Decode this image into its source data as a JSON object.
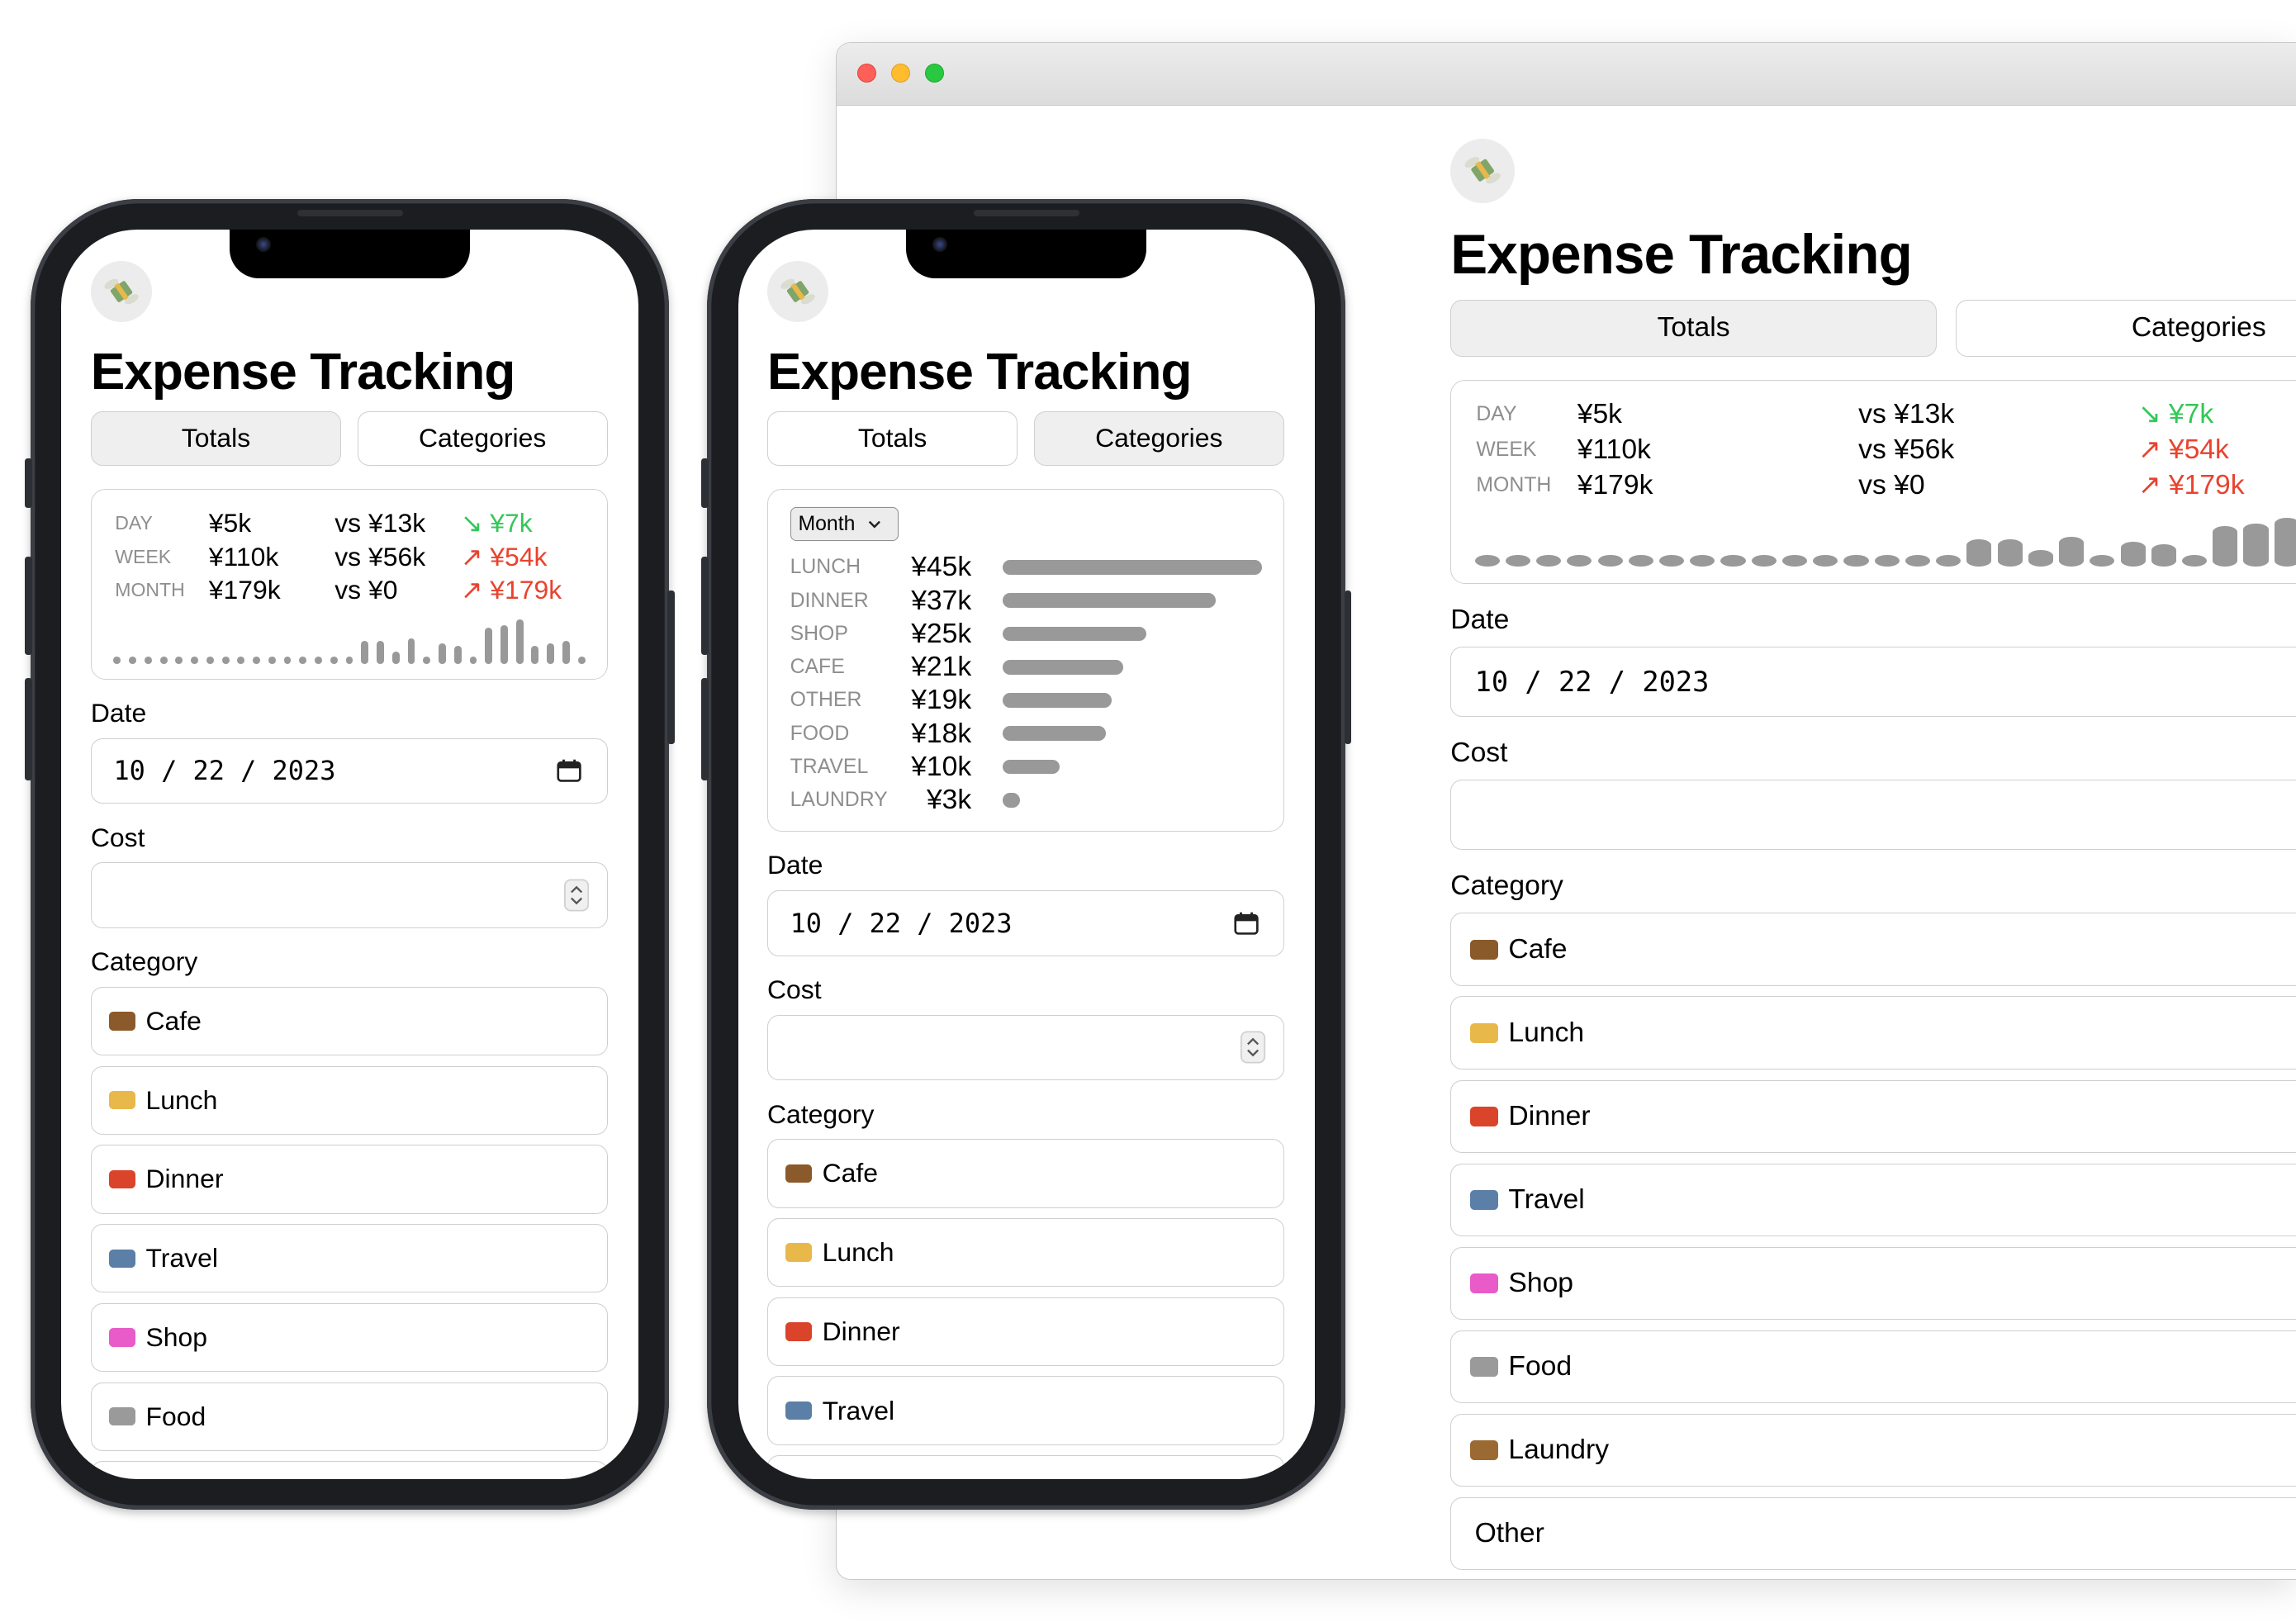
{
  "app": {
    "title": "Expense Tracking",
    "icon": "money-with-wings-icon"
  },
  "tabs": {
    "totals": "Totals",
    "categories": "Categories"
  },
  "colors": {
    "increase": "#e8432f",
    "decrease": "#34c759",
    "bar": "#999999",
    "selected_tab": "#efefef"
  },
  "stats": {
    "rows": [
      {
        "label": "DAY",
        "value": "¥5k",
        "compare": "vs ¥13k",
        "arrow": "↘",
        "change": "¥7k",
        "direction": "down"
      },
      {
        "label": "WEEK",
        "value": "¥110k",
        "compare": "vs ¥56k",
        "arrow": "↗",
        "change": "¥54k",
        "direction": "up"
      },
      {
        "label": "MONTH",
        "value": "¥179k",
        "compare": "vs ¥0",
        "arrow": "↗",
        "change": "¥179k",
        "direction": "up"
      }
    ],
    "daily_sparkline": [
      0,
      0,
      0,
      0,
      0,
      0,
      0,
      0,
      0,
      0,
      0,
      0,
      0,
      0,
      0,
      0,
      3,
      3,
      1,
      3.5,
      0,
      2.5,
      2,
      0,
      5.5,
      6,
      7,
      2,
      2.5,
      3,
      0
    ]
  },
  "category_chart": {
    "period": "Month",
    "items": [
      {
        "label": "LUNCH",
        "amount": "¥45k",
        "value": 45
      },
      {
        "label": "DINNER",
        "amount": "¥37k",
        "value": 37
      },
      {
        "label": "SHOP",
        "amount": "¥25k",
        "value": 25
      },
      {
        "label": "CAFE",
        "amount": "¥21k",
        "value": 21
      },
      {
        "label": "OTHER",
        "amount": "¥19k",
        "value": 19
      },
      {
        "label": "FOOD",
        "amount": "¥18k",
        "value": 18
      },
      {
        "label": "TRAVEL",
        "amount": "¥10k",
        "value": 10
      },
      {
        "label": "LAUNDRY",
        "amount": "¥3k",
        "value": 3
      }
    ]
  },
  "form": {
    "date_label": "Date",
    "date_value": "10 / 22 / 2023",
    "cost_label": "Cost",
    "cost_value": "",
    "category_label": "Category"
  },
  "categories": [
    {
      "label": "Cafe",
      "icon": "hot-beverage-icon",
      "color": "#8b5a2b"
    },
    {
      "label": "Lunch",
      "icon": "sandwich-icon",
      "color": "#e8b84a"
    },
    {
      "label": "Dinner",
      "icon": "spaghetti-icon",
      "color": "#d9442b"
    },
    {
      "label": "Travel",
      "icon": "tram-icon",
      "color": "#5b7fa6"
    },
    {
      "label": "Shop",
      "icon": "shopping-bags-icon",
      "color": "#e85bc8"
    },
    {
      "label": "Food",
      "icon": "shopping-cart-icon",
      "color": "#9a9a9a"
    },
    {
      "label": "Laundry",
      "icon": "basket-icon",
      "color": "#9a6a32"
    },
    {
      "label": "Other",
      "icon": "",
      "color": ""
    }
  ]
}
